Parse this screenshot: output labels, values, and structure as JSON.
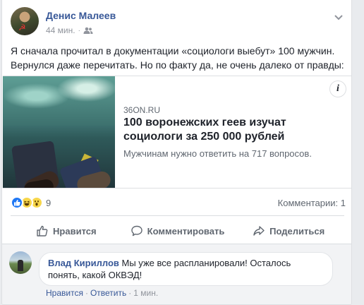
{
  "post": {
    "author": "Денис Малеев",
    "time": "44 мин.",
    "audience_icon": "friends-icon",
    "text": "Я сначала прочитал в документации «социологи выебут» 100 мужчин. Вернулся даже перечитать. Но по факту да, не очень далеко от правды:"
  },
  "link": {
    "info_label": "i",
    "source": "36ON.RU",
    "headline": "100 воронежских геев изучат социологи за 250 000 рублей",
    "description": "Мужчинам нужно ответить на 717 вопросов."
  },
  "reactions": {
    "count": "9",
    "comments": "Комментарии: 1",
    "icons": [
      "like-icon",
      "haha-icon",
      "wow-icon"
    ]
  },
  "actions": {
    "like": "Нравится",
    "comment": "Комментировать",
    "share": "Поделиться"
  },
  "comment": {
    "author": "Влад Кириллов",
    "text": "Мы уже все распланировали! Осталось понять, какой ОКВЭД!",
    "like": "Нравится",
    "sep": "·",
    "reply": "Ответить",
    "time": "1 мин."
  },
  "colors": {
    "link_blue": "#385898",
    "like_blue": "#2078f4",
    "muted": "#606770"
  }
}
